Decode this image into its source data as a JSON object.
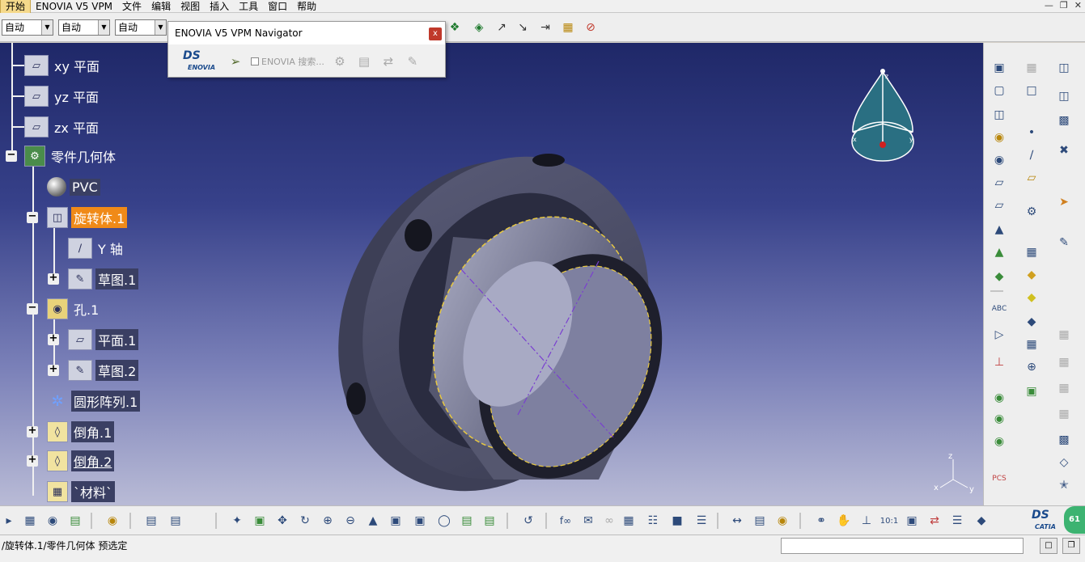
{
  "menubar": {
    "items": [
      "开始",
      "ENOVIA V5 VPM",
      "文件",
      "编辑",
      "视图",
      "插入",
      "工具",
      "窗口",
      "帮助"
    ]
  },
  "toolbar": {
    "combos": [
      "自动",
      "自动",
      "自动"
    ]
  },
  "navigator": {
    "title": "ENOVIA V5 VPM Navigator",
    "close": "x",
    "logo_ds": "DS",
    "logo_text": "ENOVIA",
    "search_label": "ENOVIA 搜索..."
  },
  "tree": {
    "nodes": [
      {
        "label": "xy 平面"
      },
      {
        "label": "yz 平面"
      },
      {
        "label": "zx 平面"
      },
      {
        "label": "零件几何体"
      },
      {
        "label": "PVC"
      },
      {
        "label": "旋转体.1"
      },
      {
        "label": "Y 轴"
      },
      {
        "label": "草图.1"
      },
      {
        "label": "孔.1"
      },
      {
        "label": "平面.1"
      },
      {
        "label": "草图.2"
      },
      {
        "label": "圆形阵列.1"
      },
      {
        "label": "倒角.1"
      },
      {
        "label": "倒角.2"
      },
      {
        "label": "`材料`"
      }
    ]
  },
  "compass": {
    "z": "z",
    "x": "x",
    "y": "y"
  },
  "triad": {
    "z": "z",
    "x": "x",
    "y": "y"
  },
  "bottombar": {
    "catia_ds": "DS",
    "catia_text": "CATIA",
    "badge": "61"
  },
  "status": {
    "text": "/旋转体.1/零件几何体 预选定"
  },
  "colors": {
    "selection": "#f08a18",
    "part": "#4a4c66",
    "background_top": "#1f2868",
    "background_bottom": "#b9bbd6"
  }
}
